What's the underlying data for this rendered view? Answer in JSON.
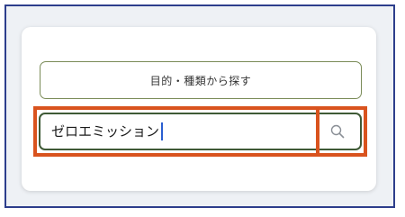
{
  "category_button": {
    "label": "目的・種類から探す"
  },
  "search": {
    "value": "ゼロエミッション",
    "icon": "search-icon"
  },
  "colors": {
    "frame_border": "#2d3e8c",
    "highlight": "#d9531e",
    "input_border": "#3f5a36",
    "button_border": "#7a8b57"
  }
}
